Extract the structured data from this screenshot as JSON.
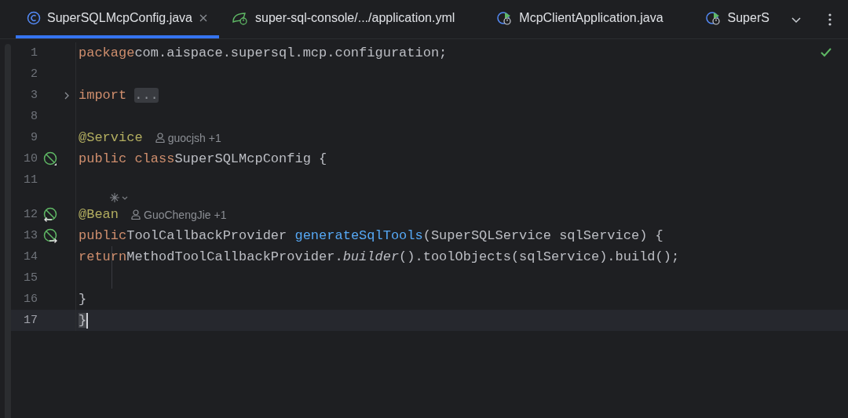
{
  "tabs": [
    {
      "label": "SuperSQLMcpConfig.java",
      "kind": "class",
      "selected": true,
      "closable": true
    },
    {
      "label": "super-sql-console/.../application.yml",
      "kind": "config",
      "selected": false,
      "closable": false
    },
    {
      "label": "McpClientApplication.java",
      "kind": "runnable",
      "selected": false,
      "closable": false
    },
    {
      "label": "SuperS",
      "kind": "runnable",
      "selected": false,
      "closable": false
    }
  ],
  "inspection_ok": true,
  "lines": [
    {
      "number": "1",
      "kind": "plain",
      "tokens": [
        {
          "text": "package",
          "kind": "keyword"
        },
        {
          "text": " com.aispace.supersql.mcp.configuration;",
          "kind": "plain"
        }
      ]
    },
    {
      "number": "2",
      "kind": "plain"
    },
    {
      "number": "3",
      "kind": "plain",
      "folded": true,
      "tokens": [
        {
          "text": "import",
          "kind": "keyword"
        },
        {
          "text": "...",
          "kind": "fold"
        }
      ]
    },
    {
      "number": "8",
      "kind": "plain"
    },
    {
      "number": "9",
      "kind": "plain",
      "tokens": [
        {
          "text": "@Service",
          "kind": "annotation"
        }
      ],
      "author": "guocjsh +1"
    },
    {
      "number": "10",
      "kind": "bean",
      "tokens": [
        {
          "text": "public class",
          "kind": "keyword"
        },
        {
          "text": " SuperSQLMcpConfig {",
          "kind": "plain"
        }
      ]
    },
    {
      "number": "11",
      "kind": "plain",
      "ai_hint": true
    },
    {
      "number": "12",
      "kind": "bean-in",
      "tokens": [
        {
          "text": "    @Bean",
          "kind": "annotation"
        }
      ],
      "author": "GuoChengJie +1"
    },
    {
      "number": "13",
      "kind": "bean-out",
      "tokens": [
        {
          "text": "    public",
          "kind": "keyword"
        },
        {
          "text": " ToolCallbackProvider ",
          "kind": "plain"
        },
        {
          "text": "generateSqlTools",
          "kind": "method"
        },
        {
          "text": "(SuperSQLService sqlService) {",
          "kind": "plain"
        }
      ]
    },
    {
      "number": "14",
      "kind": "plain",
      "guide": true,
      "tokens": [
        {
          "text": "        return",
          "kind": "keyword"
        },
        {
          "text": " MethodToolCallbackProvider.",
          "kind": "plain"
        },
        {
          "text": "builder",
          "kind": "static"
        },
        {
          "text": "().toolObjects(sqlService).build();",
          "kind": "plain"
        }
      ]
    },
    {
      "number": "15",
      "kind": "plain",
      "guide": true
    },
    {
      "number": "16",
      "kind": "plain",
      "tokens": [
        {
          "text": "    }",
          "kind": "plain"
        }
      ]
    },
    {
      "number": "17",
      "kind": "plain",
      "caret": true,
      "tokens": [
        {
          "text": "}",
          "kind": "brace-match"
        }
      ]
    }
  ]
}
